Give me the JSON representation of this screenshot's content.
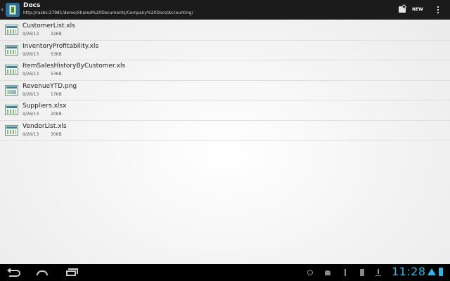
{
  "header": {
    "title": "Docs",
    "path": "http://rasbs:27981/demo/Shared%20Documents/Company%20Docs/Accounting/",
    "new_label": "NEW"
  },
  "files": [
    {
      "name": "CustomerList.xls",
      "date": "9/26/13",
      "size": "32KB",
      "icon": "spreadsheet-icon"
    },
    {
      "name": "InventoryProfitability.xls",
      "date": "9/26/13",
      "size": "53KB",
      "icon": "spreadsheet-icon"
    },
    {
      "name": "ItemSalesHistoryByCustomer.xls",
      "date": "9/26/13",
      "size": "53KB",
      "icon": "spreadsheet-icon"
    },
    {
      "name": "RevenueYTD.png",
      "date": "9/26/13",
      "size": "17KB",
      "icon": "image-icon"
    },
    {
      "name": "Suppliers.xlsx",
      "date": "9/26/13",
      "size": "20KB",
      "icon": "spreadsheet-icon"
    },
    {
      "name": "VendorList.xls",
      "date": "9/26/13",
      "size": "30KB",
      "icon": "spreadsheet-icon"
    }
  ],
  "status_bar": {
    "time": "11:28"
  },
  "colors": {
    "accent": "#33b5e5",
    "action_bar": "#1b1b1b"
  }
}
